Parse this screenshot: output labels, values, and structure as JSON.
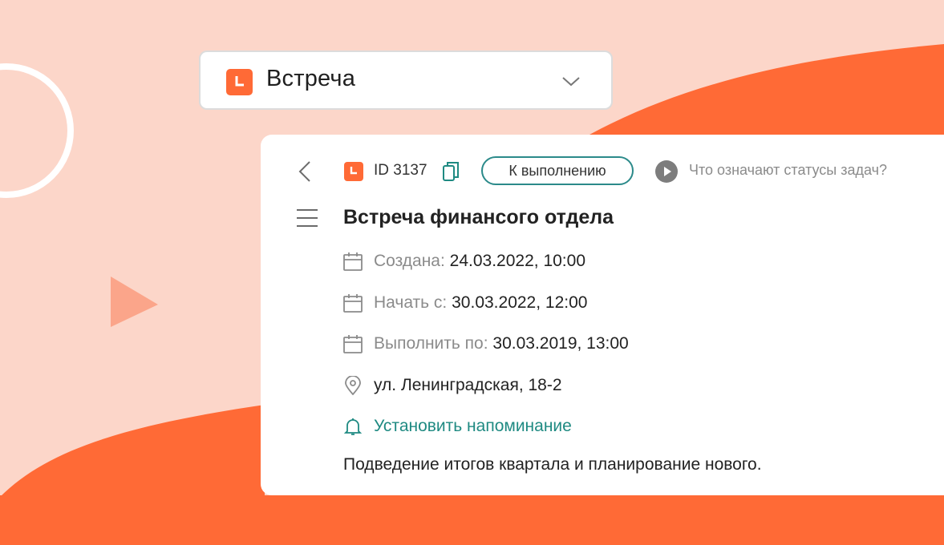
{
  "colors": {
    "accent": "#ff6a36",
    "teal": "#1f8a82",
    "background": "#fcd6c9"
  },
  "dropdown": {
    "label": "Встреча",
    "icon": "task-clock-icon"
  },
  "card": {
    "id_label": "ID 3137",
    "status_label": "К выполнению",
    "help_link": "Что означают статусы задач?",
    "title": "Встреча финансого отдела",
    "created_label": "Создана:",
    "created_value": "24.03.2022, 10:00",
    "start_label": "Начать с:",
    "start_value": "30.03.2022, 12:00",
    "due_label": "Выполнить по:",
    "due_value": "30.03.2019, 13:00",
    "location": "ул. Ленинградская, 18-2",
    "reminder_label": "Установить напоминание",
    "description": "Подведение итогов квартала и планирование нового."
  }
}
